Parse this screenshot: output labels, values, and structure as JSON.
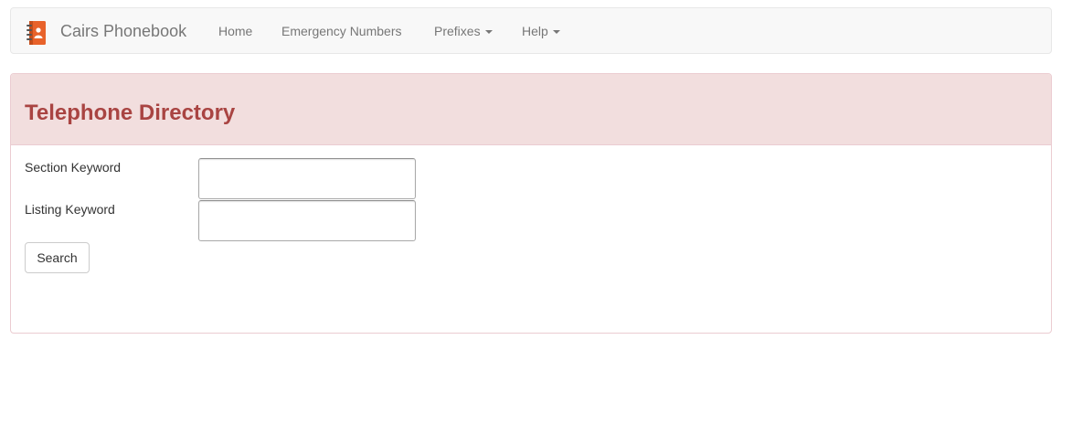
{
  "navbar": {
    "brand": "Cairs Phonebook",
    "items": [
      {
        "label": "Home",
        "dropdown": false
      },
      {
        "label": "Emergency Numbers",
        "dropdown": false
      },
      {
        "label": "Prefixes",
        "dropdown": true
      },
      {
        "label": "Help",
        "dropdown": true
      }
    ]
  },
  "panel": {
    "title": "Telephone Directory",
    "fields": [
      {
        "label": "Section Keyword",
        "value": ""
      },
      {
        "label": "Listing Keyword",
        "value": ""
      }
    ],
    "search_button": "Search"
  },
  "colors": {
    "navbar_bg": "#f8f8f8",
    "panel_heading_bg": "#f2dede",
    "panel_title": "#a94442",
    "logo_orange": "#e8622a"
  }
}
